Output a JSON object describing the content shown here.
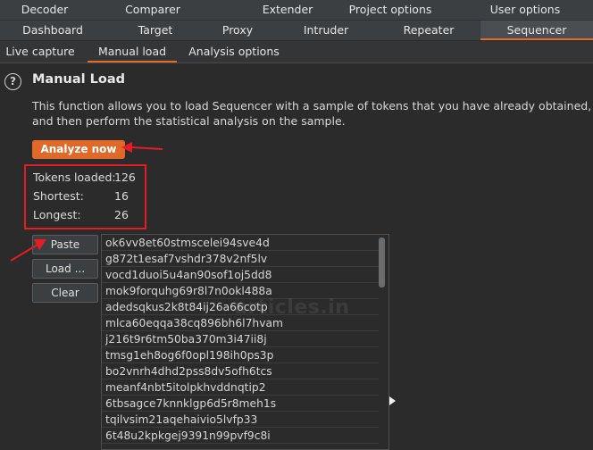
{
  "tabs_row1": [
    "Decoder",
    "Comparer",
    "Extender",
    "Project options",
    "User options"
  ],
  "tabs_row2": [
    "Dashboard",
    "Target",
    "Proxy",
    "Intruder",
    "Repeater",
    "Sequencer"
  ],
  "active_tab": "Sequencer",
  "subtabs": [
    "Live capture",
    "Manual load",
    "Analysis options"
  ],
  "active_subtab": "Manual load",
  "help_glyph": "?",
  "page_title": "Manual Load",
  "description": "This function allows you to load Sequencer with a sample of tokens that you have already obtained, and then perform the statistical analysis on the sample.",
  "analyze_label": "Analyze now",
  "stats": [
    {
      "label": "Tokens loaded:",
      "value": "126"
    },
    {
      "label": "Shortest:",
      "value": "16"
    },
    {
      "label": "Longest:",
      "value": "26"
    }
  ],
  "buttons": {
    "paste": "Paste",
    "load": "Load ...",
    "clear": "Clear"
  },
  "tokens": [
    "ok6vv8et60stmscelei94sve4d",
    "g872t1esaf7vshdr378v2nf5lv",
    "vocd1duoi5u4an90sof1oj5dd8",
    "mok9forquhg69r8l7n0okl488a",
    "adedsqkus2k8t84ij26a66cotp",
    "mlca60eqqa38cq896bh6l7hvam",
    "j216t9r6tm50ba370m3i47ii8j",
    "tmsg1eh8og6f0opl198ih0ps3p",
    "bo2vnrh4dhd2pss8dv5ofh6tcs",
    "meanf4nbt5itolpkhvddnqtip2",
    "6tbsagce7knnklgp6d5r8meh1s",
    "tqilvsim21aqehaivio5lvfp33",
    "6t48u2kpkgej9391n99pvf9c8i"
  ],
  "watermark": "articles.in",
  "colors": {
    "accent": "#e0692a",
    "highlight_border": "#e51c23",
    "tab_bar": "#3b3f42",
    "background": "#2b2b2b"
  }
}
